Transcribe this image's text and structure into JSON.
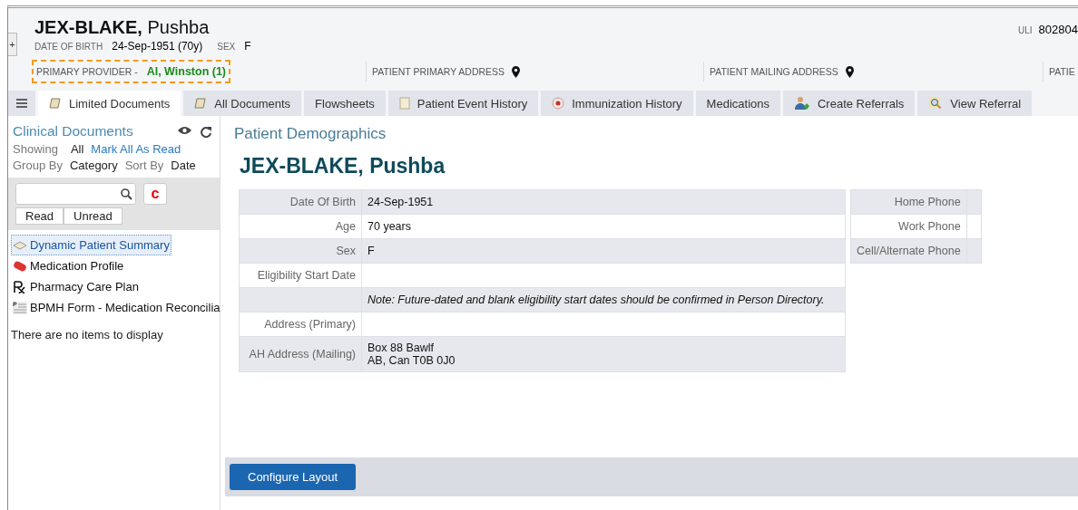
{
  "patient": {
    "surname": "JEX-BLAKE,",
    "given": "Pushba",
    "dob_label": "DATE OF BIRTH",
    "dob": "24-Sep-1951 (70y)",
    "sex_label": "SEX",
    "sex": "F",
    "uli_label": "ULI",
    "uli": "802804"
  },
  "expand_button": "+",
  "info_bar": [
    {
      "kind": "provider",
      "label": "PRIMARY PROVIDER -",
      "value": "Al, Winston (1)"
    },
    {
      "kind": "address",
      "label": "PATIENT PRIMARY ADDRESS"
    },
    {
      "kind": "address",
      "label": "PATIENT MAILING ADDRESS"
    },
    {
      "kind": "plain",
      "label": "PATIE"
    }
  ],
  "tabs": [
    {
      "kind": "menu",
      "selected": false
    },
    {
      "kind": "scroll",
      "label": "Limited Documents",
      "selected": true
    },
    {
      "kind": "scroll",
      "label": "All Documents",
      "selected": false
    },
    {
      "kind": "none",
      "label": "Flowsheets",
      "selected": false
    },
    {
      "kind": "page",
      "label": "Patient Event History",
      "selected": false
    },
    {
      "kind": "badge",
      "label": "Immunization History",
      "selected": false
    },
    {
      "kind": "none",
      "label": "Medications",
      "selected": false
    },
    {
      "kind": "person",
      "label": "Create Referrals",
      "selected": false
    },
    {
      "kind": "magnifier",
      "label": "View Referral",
      "selected": false
    }
  ],
  "sidebar": {
    "title": "Clinical Documents",
    "showing_label": "Showing",
    "showing_value": "All",
    "mark_all": "Mark All As Read",
    "group_label": "Group By",
    "group_value": "Category",
    "sort_label": "Sort By",
    "sort_value": "Date",
    "clear_button": "c",
    "filters": [
      "Read",
      "Unread"
    ],
    "items": [
      {
        "kind": "summary",
        "label": "Dynamic Patient Summary",
        "selected": true
      },
      {
        "kind": "pill",
        "label": "Medication Profile",
        "selected": false
      },
      {
        "kind": "rx",
        "label": "Pharmacy Care Plan",
        "selected": false
      },
      {
        "kind": "form",
        "label": "BPMH Form - Medication Reconcilia",
        "selected": false
      }
    ],
    "empty_message": "There are no items to display"
  },
  "main": {
    "section_title": "Patient Demographics",
    "name": "JEX-BLAKE, Pushba",
    "rows": [
      {
        "label": "Date Of Birth",
        "value": "24-Sep-1951"
      },
      {
        "label": "Age",
        "value": "70 years"
      },
      {
        "label": "Sex",
        "value": "F"
      },
      {
        "label": "Eligibility Start Date",
        "value": ""
      },
      {
        "label": "",
        "value": "Note: Future-dated and blank eligibility start dates should be confirmed in Person Directory.",
        "kind": "note"
      },
      {
        "label": "Address (Primary)",
        "value": ""
      },
      {
        "label": "AH Address (Mailing)",
        "value": "Box 88 Bawlf\nAB, Can T0B 0J0"
      }
    ],
    "phones": [
      "Home Phone",
      "Work Phone",
      "Cell/Alternate Phone"
    ],
    "configure_button": "Configure Layout"
  }
}
